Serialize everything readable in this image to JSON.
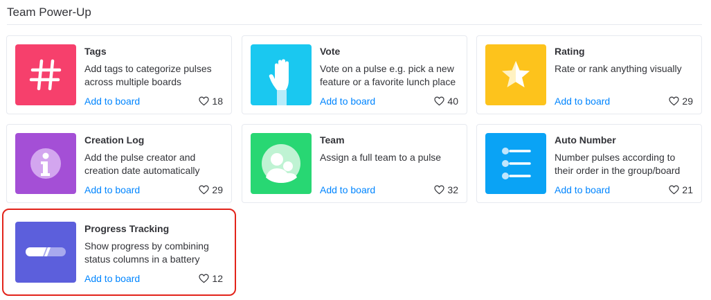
{
  "section": {
    "title": "Team Power-Up"
  },
  "cards": [
    {
      "name": "Tags",
      "description": "Add tags to categorize pulses across multiple boards",
      "action": "Add to board",
      "likes": "18",
      "color": "#f6406c",
      "icon": "hashtag-icon"
    },
    {
      "name": "Vote",
      "description": "Vote on a pulse e.g. pick a new feature or a favorite lunch place",
      "action": "Add to board",
      "likes": "40",
      "color": "#1ac8f0",
      "icon": "raised-hand-icon"
    },
    {
      "name": "Rating",
      "description": "Rate or rank anything visually",
      "action": "Add to board",
      "likes": "29",
      "color": "#fdc31c",
      "icon": "star-icon"
    },
    {
      "name": "Creation Log",
      "description": "Add the pulse creator and creation date automatically",
      "action": "Add to board",
      "likes": "29",
      "color": "#a44fd6",
      "icon": "info-icon"
    },
    {
      "name": "Team",
      "description": "Assign a full team to a pulse",
      "action": "Add to board",
      "likes": "32",
      "color": "#28d773",
      "icon": "people-icon"
    },
    {
      "name": "Auto Number",
      "description": "Number pulses according to their order in the group/board",
      "action": "Add to board",
      "likes": "21",
      "color": "#0aa3f5",
      "icon": "numbered-list-icon"
    },
    {
      "name": "Progress Tracking",
      "description": "Show progress by combining status columns in a battery",
      "action": "Add to board",
      "likes": "12",
      "color": "#5c5fdc",
      "icon": "progress-battery-icon"
    }
  ]
}
